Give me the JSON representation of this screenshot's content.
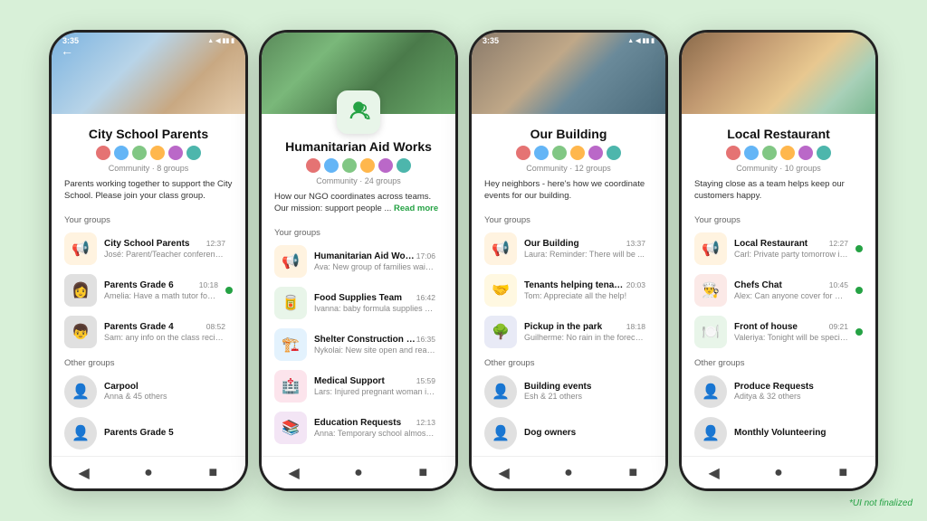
{
  "watermark": "*UI not finalized",
  "phones": [
    {
      "id": "phone1",
      "statusTime": "3:35",
      "headerType": "school",
      "hasBack": true,
      "communityTitle": "City School Parents",
      "communityMeta": "Community · 8 groups",
      "communityDesc": "Parents working together to support the City School. Please join your class group.",
      "hasReadMore": false,
      "yourGroupsLabel": "Your groups",
      "yourGroups": [
        {
          "name": "City School Parents",
          "preview": "José: Parent/Teacher conferences ...",
          "time": "12:37",
          "hasDot": false,
          "iconType": "megaphone",
          "emoji": "📢"
        },
        {
          "name": "Parents Grade 6",
          "preview": "Amelia: Have a math tutor for the upco...",
          "time": "10:18",
          "hasDot": true,
          "iconType": "avatar",
          "emoji": "👩"
        },
        {
          "name": "Parents Grade 4",
          "preview": "Sam: any info on the class recital?",
          "time": "08:52",
          "hasDot": false,
          "iconType": "avatar",
          "emoji": "👦"
        }
      ],
      "otherGroupsLabel": "Other groups",
      "otherGroups": [
        {
          "name": "Carpool",
          "sub": "Anna & 45 others"
        },
        {
          "name": "Parents Grade 5",
          "sub": ""
        }
      ]
    },
    {
      "id": "phone2",
      "statusTime": "",
      "headerType": "ngo",
      "hasBack": false,
      "hasCommunityIcon": true,
      "communityTitle": "Humanitarian Aid Works",
      "communityMeta": "Community · 24 groups",
      "communityDesc": "How our NGO coordinates across teams. Our mission: support people ...",
      "hasReadMore": true,
      "readMoreText": "Read more",
      "yourGroupsLabel": "Your groups",
      "yourGroups": [
        {
          "name": "Humanitarian Aid Works",
          "preview": "Ava: New group of families waiting ...",
          "time": "17:06",
          "hasDot": false,
          "iconType": "megaphone",
          "emoji": "📢"
        },
        {
          "name": "Food Supplies Team",
          "preview": "Ivanna: baby formula supplies running ...",
          "time": "16:42",
          "hasDot": false,
          "iconType": "food",
          "emoji": "🥫"
        },
        {
          "name": "Shelter Construction Team",
          "preview": "Nykolai: New site open and ready for ...",
          "time": "16:35",
          "hasDot": false,
          "iconType": "shelter",
          "emoji": "🏗️"
        },
        {
          "name": "Medical Support",
          "preview": "Lars: Injured pregnant woman in need ...",
          "time": "15:59",
          "hasDot": false,
          "iconType": "medical",
          "emoji": "🏥"
        },
        {
          "name": "Education Requests",
          "preview": "Anna: Temporary school almost comp...",
          "time": "12:13",
          "hasDot": false,
          "iconType": "education",
          "emoji": "📚"
        }
      ],
      "otherGroupsLabel": "",
      "otherGroups": []
    },
    {
      "id": "phone3",
      "statusTime": "3:35",
      "headerType": "building",
      "hasBack": false,
      "communityTitle": "Our Building",
      "communityMeta": "Community · 12 groups",
      "communityDesc": "Hey neighbors - here's how we coordinate events for our building.",
      "hasReadMore": false,
      "yourGroupsLabel": "Your groups",
      "yourGroups": [
        {
          "name": "Our Building",
          "preview": "Laura: Reminder: There will be ...",
          "time": "13:37",
          "hasDot": false,
          "iconType": "megaphone",
          "emoji": "📢",
          "hasPinIcon": true
        },
        {
          "name": "Tenants helping tenants",
          "preview": "Tom: Appreciate all the help!",
          "time": "20:03",
          "hasDot": false,
          "iconType": "tenants",
          "emoji": "🤝"
        },
        {
          "name": "Pickup in the park",
          "preview": "Guilherme: No rain in the forecast!",
          "time": "18:18",
          "hasDot": false,
          "iconType": "pickup",
          "emoji": "🌳"
        }
      ],
      "otherGroupsLabel": "Other groups",
      "otherGroups": [
        {
          "name": "Building events",
          "sub": "Esh & 21 others"
        },
        {
          "name": "Dog owners",
          "sub": ""
        }
      ]
    },
    {
      "id": "phone4",
      "statusTime": "",
      "headerType": "restaurant",
      "hasBack": false,
      "communityTitle": "Local Restaurant",
      "communityMeta": "Community · 10 groups",
      "communityDesc": "Staying close as a team helps keep our customers happy.",
      "hasReadMore": false,
      "yourGroupsLabel": "Your groups",
      "yourGroups": [
        {
          "name": "Local Restaurant",
          "preview": "Carl: Private party tomorrow in the ...",
          "time": "12:27",
          "hasDot": true,
          "iconType": "megaphone",
          "emoji": "📢"
        },
        {
          "name": "Chefs Chat",
          "preview": "Alex: Can anyone cover for me?",
          "time": "10:45",
          "hasDot": true,
          "iconType": "chefs",
          "emoji": "👨‍🍳"
        },
        {
          "name": "Front of house",
          "preview": "Valeriya: Tonight will be special!",
          "time": "09:21",
          "hasDot": true,
          "iconType": "front",
          "emoji": "🍽️"
        }
      ],
      "otherGroupsLabel": "Other groups",
      "otherGroups": [
        {
          "name": "Produce Requests",
          "sub": "Aditya & 32 others"
        },
        {
          "name": "Monthly Volunteering",
          "sub": ""
        }
      ]
    }
  ]
}
